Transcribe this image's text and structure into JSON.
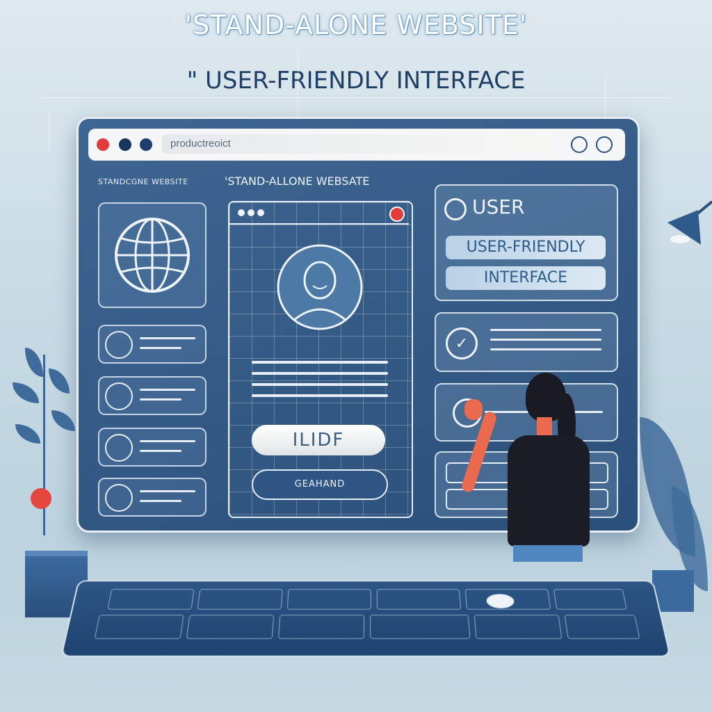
{
  "headline": "'STAND-ALONE WEBSITE'",
  "subheadline": "\" USER-FRIENDLY INTERFACE",
  "browser": {
    "address": "productreoict",
    "left_tagline": "STANDCGNE WEBSITE",
    "center_tagline": "'STAND-ALLONE WEBSATE",
    "window_dot_colors": [
      "#e23b3b",
      "#17365d",
      "#1e3f6c"
    ]
  },
  "phone": {
    "primary_button": "ILIDF",
    "secondary_button": "GEAHAND"
  },
  "right_panel": {
    "user_label": "USER",
    "pill_1": "USER-FRIENDLY",
    "pill_2": "INTERFACE"
  },
  "colors": {
    "accent": "#e23b3b",
    "navy": "#2b4f7b",
    "panel_line": "#e8eef5"
  }
}
